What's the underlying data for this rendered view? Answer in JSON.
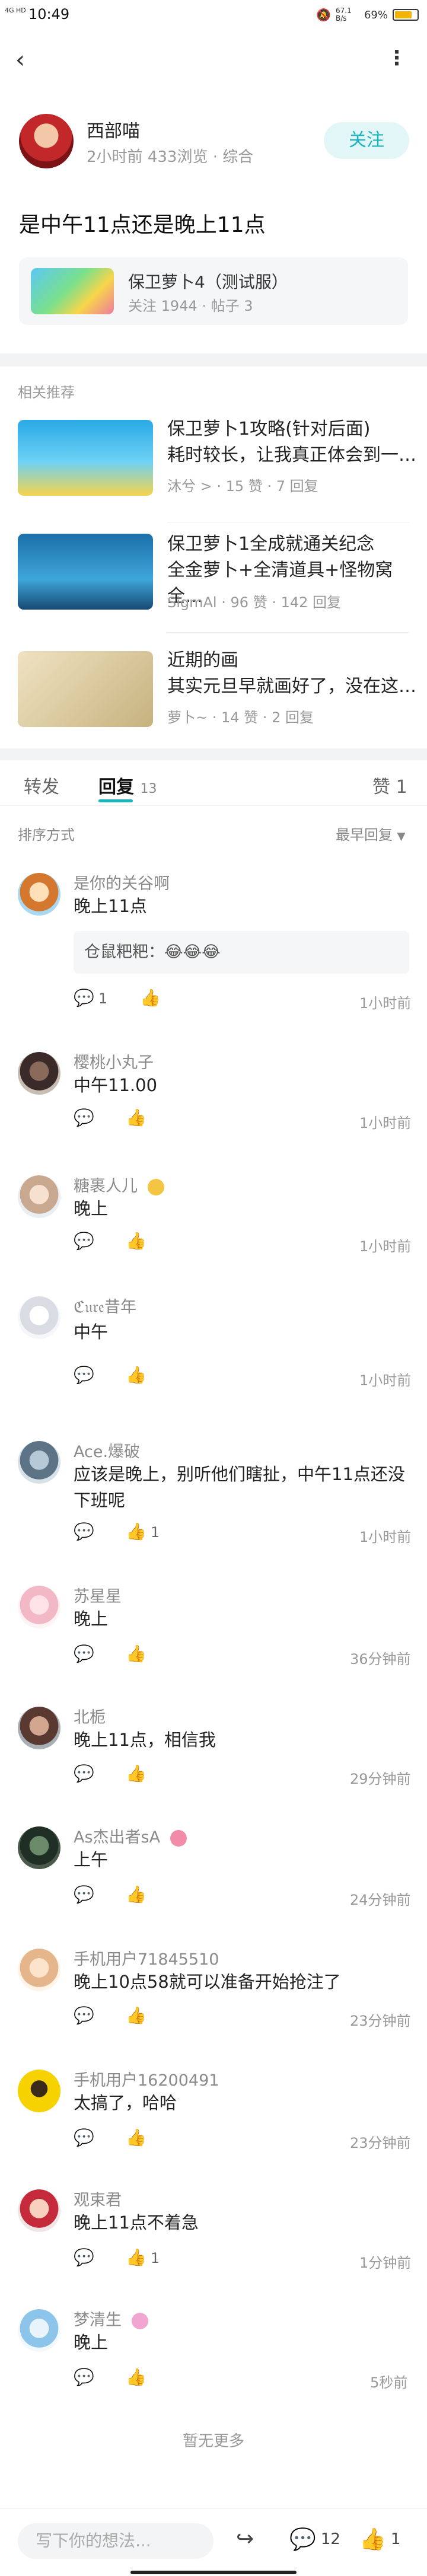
{
  "status_bar": {
    "time": "10:49",
    "signal": "4G HD",
    "network_speed": "67.1 B/s",
    "battery": "69%"
  },
  "author": {
    "name": "西部喵",
    "time": "2小时前",
    "views": "433浏览",
    "category": "综合",
    "follow_label": "关注"
  },
  "post": {
    "title": "是中午11点还是晚上11点"
  },
  "game": {
    "name": "保卫萝卜4（测试服）",
    "followers": "关注 1944",
    "posts": "帖子 3"
  },
  "related": {
    "label": "相关推荐",
    "items": [
      {
        "title1": "保卫萝卜1攻略(针对后面)",
        "title2": "耗时较长，让我真正体会到一…",
        "author": "沐兮 >",
        "likes": "15 赞",
        "replies": "7 回复"
      },
      {
        "title1": "保卫萝卜1全成就通关纪念",
        "title2": "全金萝卜+全清道具+怪物窝全…",
        "author": "SigmAl",
        "likes": "96 赞",
        "replies": "142 回复"
      },
      {
        "title1": "近期的画",
        "title2": "其实元旦早就画好了，没在这…",
        "author": "萝卜~",
        "likes": "14 赞",
        "replies": "2 回复"
      }
    ]
  },
  "tabs": {
    "forward": "转发",
    "reply": "回复",
    "reply_count": "13",
    "like": "赞 1"
  },
  "sort": {
    "label": "排序方式",
    "value": "最早回复"
  },
  "comments": [
    {
      "name": "是你的关谷啊",
      "text": "晚上11点",
      "reply": "仓鼠粑粑：😂😂😂",
      "reply_count": "1",
      "like_count": "",
      "time": "1小时前"
    },
    {
      "name": "樱桃小丸子",
      "text": "中午11.00",
      "reply_count": "",
      "like_count": "",
      "time": "1小时前"
    },
    {
      "name": "糖裹人儿",
      "text": "晚上",
      "reply_count": "",
      "like_count": "",
      "time": "1小时前"
    },
    {
      "name": "ℭ𝔲𝔯𝔢昔年",
      "text": "中午",
      "reply_count": "",
      "like_count": "",
      "time": "1小时前"
    },
    {
      "name": "Ace.爆破",
      "text": "应该是晚上，别听他们瞎扯，中午11点还没下班呢",
      "reply_count": "",
      "like_count": "1",
      "time": "1小时前"
    },
    {
      "name": "苏星星",
      "text": "晚上",
      "reply_count": "",
      "like_count": "",
      "time": "36分钟前"
    },
    {
      "name": "北栀",
      "text": "晚上11点，相信我",
      "reply_count": "",
      "like_count": "",
      "time": "29分钟前"
    },
    {
      "name": "As杰出者sA",
      "text": "上午",
      "reply_count": "",
      "like_count": "",
      "time": "24分钟前"
    },
    {
      "name": "手机用户71845510",
      "text": "晚上10点58就可以准备开始抢注了",
      "reply_count": "",
      "like_count": "",
      "time": "23分钟前"
    },
    {
      "name": "手机用户16200491",
      "text": "太搞了，哈哈",
      "reply_count": "",
      "like_count": "",
      "time": "23分钟前"
    },
    {
      "name": "观束君",
      "text": "晚上11点不着急",
      "reply_count": "",
      "like_count": "1",
      "time": "1分钟前"
    },
    {
      "name": "梦清生",
      "text": "晚上",
      "reply_count": "",
      "like_count": "",
      "time": "5秒前"
    }
  ],
  "no_more": "暂无更多",
  "bottom": {
    "placeholder": "写下你的想法...",
    "comment_count": "12",
    "like_count": "1"
  }
}
